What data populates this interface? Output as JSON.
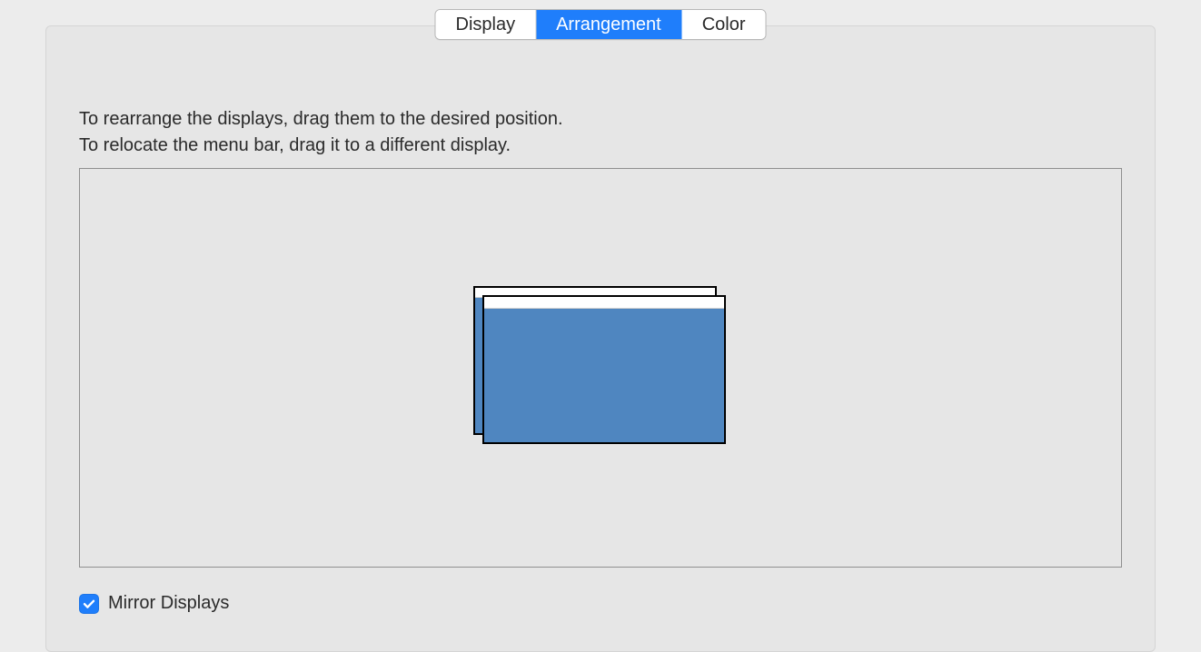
{
  "tabs": {
    "display": "Display",
    "arrangement": "Arrangement",
    "color": "Color",
    "active": "arrangement"
  },
  "instructions": {
    "line1": "To rearrange the displays, drag them to the desired position.",
    "line2": "To relocate the menu bar, drag it to a different display."
  },
  "mirror": {
    "label": "Mirror Displays",
    "checked": true
  },
  "colors": {
    "accent": "#1f7efb",
    "display_fill": "#4f86c0"
  }
}
